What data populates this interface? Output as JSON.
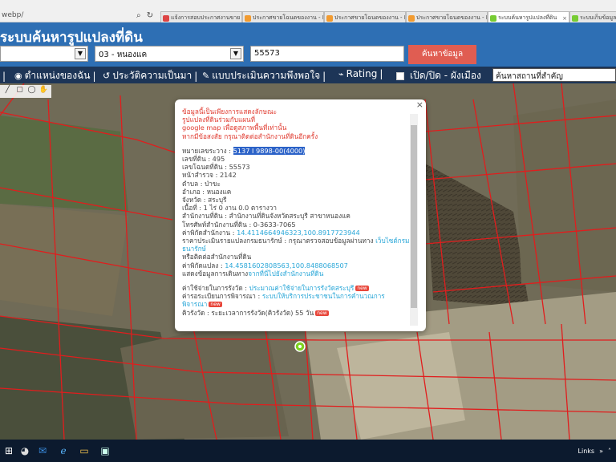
{
  "browser": {
    "address": "webp/",
    "address_icons": [
      "search-icon",
      "refresh-icon",
      "close-icon"
    ],
    "tabs": [
      {
        "label": "แจ้งการสอบประกาศงานขาย 4046...",
        "icon": "gmail-icon",
        "active": false
      },
      {
        "label": "ประกาศขายโฉนดของงาน - DDtee...",
        "icon": "ddtee-icon",
        "active": false
      },
      {
        "label": "ประกาศขายโฉนดของงาน - DDtee...",
        "icon": "ddtee-icon",
        "active": false
      },
      {
        "label": "ประกาศขายโฉนดของงาน - DDtee...",
        "icon": "ddtee-icon",
        "active": false
      },
      {
        "label": "ระบบค้นหารูปแปลงที่ดิน",
        "icon": "land-icon",
        "active": true
      },
      {
        "label": "ระบบเก็บข้อมูลเชิงพื้นที่ดิน",
        "icon": "land-icon",
        "active": false
      }
    ]
  },
  "header": {
    "title": "ระบบค้นหารูปแปลงที่ดิน",
    "select_left": "",
    "select_district": "03 - หนองแค",
    "parcel_input": "55573",
    "search_button": "ค้นหาข้อมูล"
  },
  "menu": {
    "item0": "่",
    "location": "ตำแหน่งของฉัน",
    "history": "ประวัติความเป็นมา",
    "survey": "แบบประเมินความพึงพอใจ",
    "rating": "Rating",
    "toggle": "เปิด/ปิด - ผังเมือง",
    "place_search_placeholder": "ค้นหาสถานที่สำคัญ"
  },
  "popup": {
    "warn1": "ข้อมูลนี้เป็นเพียงการแสดงลักษณะ",
    "warn2": "รูปแปลงที่ดินร่วมกับแผนที่",
    "warn3": "google map เพื่อดูสภาพพื้นที่เท่านั้น",
    "warn4": "หากมีข้อสงสัย กรุณาติดต่อสำนักงานที่ดินอีกครั้ง",
    "sheet_label": "หมายเลขระวาง :",
    "sheet_value": "5137 I 9898-00(4000)",
    "land_no": "เลขที่ดิน : 495",
    "deed_no": "เลขโฉนดที่ดิน : 55573",
    "page_no": "หน้าสำรวจ : 2142",
    "subdistrict": "ตำบล : ป่าขะ",
    "district": "อำเภอ : หนองแค",
    "province": "จังหวัด : สระบุรี",
    "area": "เนื้อที่ : 1 ไร่ 0 งาน 0.0 ตารางวา",
    "office": "สำนักงานที่ดิน : สำนักงานที่ดินจังหวัดสระบุรี สาขาหนองแค",
    "phone": "โทรศัพท์สำนักงานที่ดิน : 0-3633-7065",
    "office_coord_label": "ค่าพิกัดสำนักงาน :",
    "office_coord_value": "14.4114664946323,100.8917723944",
    "price_label": "ราคาประเมินรายแปลงกรมธนารักษ์ : กรุณาตรวจสอบข้อมูลผ่านทาง",
    "price_link": "เว็บไซต์กรมธนารักษ์",
    "contact": "หรือติดต่อสำนักงานที่ดิน",
    "parcel_coord_label": "ค่าพิกัดแปลง :",
    "parcel_coord_value": "14.4581602808563,100.8488068507",
    "route_label": "แสดงข้อมูลการเดินทาง",
    "route_link": "จากที่นี่ไปยังสำนักงานที่ดิน",
    "fee_label": "ค่าใช้จ่ายในการรังวัด :",
    "fee_link": "ประมาณค่าใช้จ่ายในการรังวัดสระบุรี",
    "queue_label": "ค่ารอระเบียนการพิจารณา :",
    "queue_link": "ระบบให้บริการประชาชนในการคำนวณการพิจารณา",
    "survey_label": "คิวรังวัด : ระยะเวลาการรังวัด(คิวรังวัด) 55 วัน",
    "new_badge": "new"
  },
  "taskbar": {
    "links_label": "Links",
    "apps": [
      "start-icon",
      "chrome-icon",
      "outlook-icon",
      "ie-icon",
      "explorer-icon",
      "photos-icon"
    ]
  }
}
